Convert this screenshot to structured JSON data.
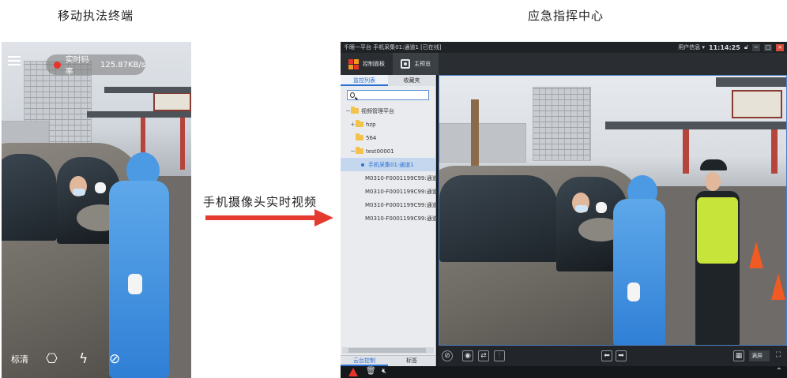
{
  "captions": {
    "left": "移动执法终端",
    "right": "应急指挥中心",
    "arrow": "手机摄像头实时视频"
  },
  "phone": {
    "rate_label": "实时码率",
    "rate_value": "125.87KB/s",
    "quality": "标清",
    "icons": [
      "menu-icon",
      "camera-switch-icon",
      "flash-off-icon",
      "disable-icon"
    ]
  },
  "client": {
    "title": "千眼一平台  手机采集01:通道1 [已在线]",
    "user_menu": "用户信息 ▾",
    "time": "11:14:25",
    "window_controls": [
      "−",
      "□",
      "×"
    ],
    "tabs": [
      {
        "label": "控制面板",
        "icon": "app-logo-icon"
      },
      {
        "label": "主预览",
        "icon": "preview-icon"
      }
    ],
    "sidebar_tabs": [
      "监控列表",
      "收藏夹"
    ],
    "search": {
      "value": "",
      "placeholder": ""
    },
    "tree": [
      {
        "label": "视频管理平台",
        "level": 0,
        "type": "folder",
        "toggle": "−"
      },
      {
        "label": "hzp",
        "level": 1,
        "type": "folder",
        "toggle": "+"
      },
      {
        "label": "564",
        "level": 1,
        "type": "folder",
        "toggle": ""
      },
      {
        "label": "test00001",
        "level": 1,
        "type": "folder",
        "toggle": "−"
      },
      {
        "label": "手机采集01:通道1",
        "level": 2,
        "type": "channel",
        "selected": true
      },
      {
        "label": "M0310-F0001199C99:通道",
        "level": 2,
        "type": "channel"
      },
      {
        "label": "M0310-F0001199C99:通道",
        "level": 2,
        "type": "channel"
      },
      {
        "label": "M0310-F0001199C99:通道",
        "level": 2,
        "type": "channel"
      },
      {
        "label": "M0310-F0001199C99:通道",
        "level": 2,
        "type": "channel"
      }
    ],
    "sidebar_bottom_tabs": [
      "云台控制",
      "标签"
    ],
    "video_split": "满屏",
    "accent": "#2a6fd1",
    "alarm_color": "#e8332a"
  }
}
